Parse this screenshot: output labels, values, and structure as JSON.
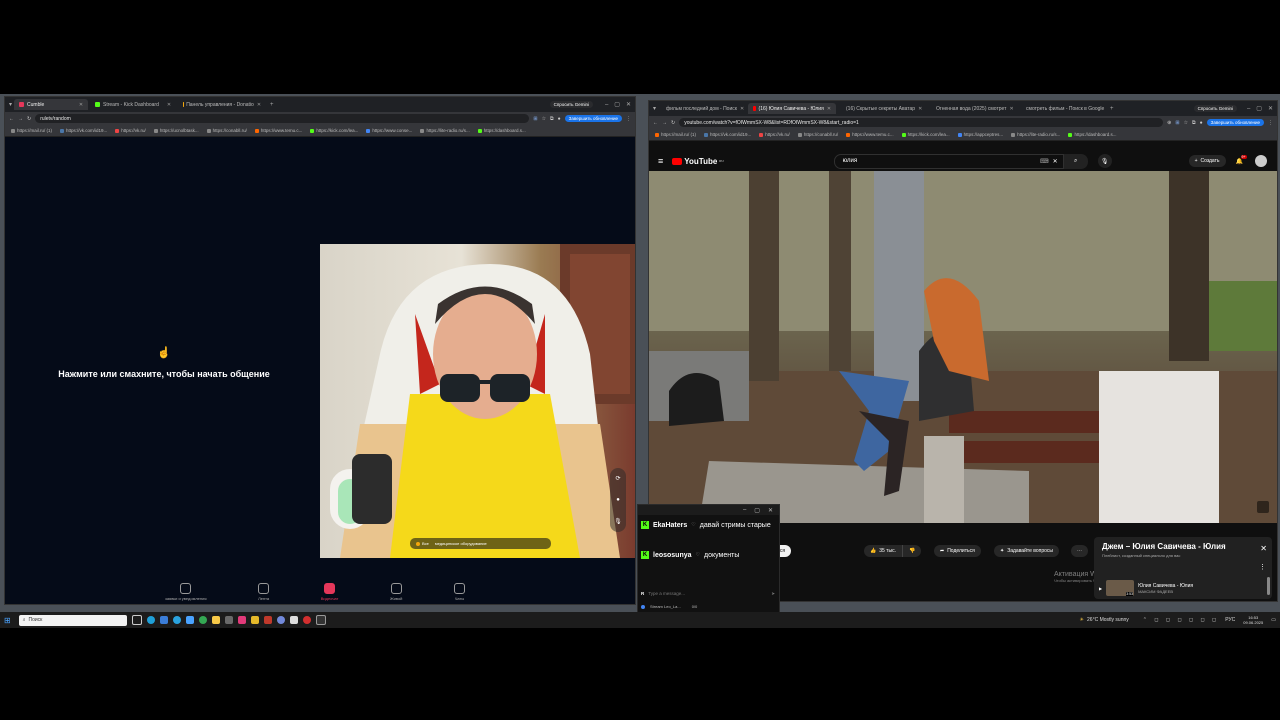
{
  "left_browser": {
    "gemini_label": "Спросить Gemini",
    "tabs": [
      {
        "label": "Cumble",
        "color": "#e6375a",
        "active": true
      },
      {
        "label": "Stream - Kick Dashboard",
        "color": "#53fc18",
        "active": false
      },
      {
        "label": "Панель управления - Donatio",
        "color": "#f4a70b",
        "active": false
      }
    ],
    "url": "ruletv/random",
    "update_label": "Завершить обновление",
    "bookmarks": [
      "https://mail.ru/ (1)",
      "https://vk.com/id19...",
      "https://vk.ru/",
      "https://ucnolbtask...",
      "https://conabll.ru/",
      "https://www.temu.c...",
      "https://kick.com/lea...",
      "https://www.conse...",
      "https://lite-radio.ru/s...",
      "https://dashboard.s..."
    ],
    "prompt": "Нажмите или смахните, чтобы начать общение",
    "cam_overlay": {
      "all_label": "Все",
      "equipment_label": "медицинское оборудование"
    },
    "bottom_nav": [
      {
        "label": "заявки и уведомления",
        "icon": "person-icon",
        "active": false
      },
      {
        "label": "Лента",
        "icon": "feed-icon",
        "active": false
      },
      {
        "label": "Видеочат",
        "icon": "video-chat-icon",
        "active": true
      },
      {
        "label": "Живой",
        "icon": "live-icon",
        "active": false
      },
      {
        "label": "Чаты",
        "icon": "chats-icon",
        "active": false
      }
    ]
  },
  "right_browser": {
    "gemini_label": "Спросить Gemini",
    "tabs": [
      {
        "label": "фильм последний дом - Поиск",
        "color": "#4285f4",
        "active": false
      },
      {
        "label": "(16) Юлия Савичева - Юлия",
        "color": "#ff0000",
        "active": true
      },
      {
        "label": "(16) Скрытые секреты Аватар",
        "color": "#ff0000",
        "active": false
      },
      {
        "label": "Огненная вода (2025) смотрет",
        "color": "#777777",
        "active": false
      },
      {
        "label": "смотреть фильм - Поиск в Google",
        "color": "#4285f4",
        "active": false
      }
    ],
    "url": "youtube.com/watch?v=fOIWmmSX-W8&list=RDfOIWmmSX-W8&start_radio=1",
    "update_label": "Завершить обновление",
    "bookmarks": [
      "https://mail.ru/ (1)",
      "https://vk.com/id19...",
      "https://vk.ru/",
      "https://conabll.ru/",
      "https://www.temu.c...",
      "https://kick.com/lea...",
      "https://appceptres...",
      "https://lite-radio.ru/s...",
      "https://dashboard.s..."
    ],
    "youtube": {
      "logo": "YouTube",
      "logo_sup": "RU",
      "search_value": "юлия",
      "create_label": "Создать",
      "notif_count": "9+",
      "subscribe_label": "ться",
      "likes": "35 тыс.",
      "share_label": "Поделиться",
      "ask_label": "Задавайте вопросы",
      "playlist_title": "Джем – Юлия Савичева - Юлия",
      "playlist_sub": "Плейлист, созданный специально для вас",
      "video_title": "Юлия Савичева - Юлия",
      "video_channel": "МАКСИМ ФАДЕЕВ",
      "video_duration": "3:53",
      "activation_title": "Активация Windows",
      "activation_sub": "Чтобы активировать Windows, перейдите"
    }
  },
  "chat": {
    "messages": [
      {
        "user": "EkaHaters",
        "text": "давай стримы старые"
      },
      {
        "user": "leososunya",
        "text": "документы"
      }
    ],
    "input_placeholder": "Type a message...",
    "count": "0/0",
    "status_label": "Stream Leo_La..."
  },
  "taskbar": {
    "search_placeholder": "Поиск",
    "weather": "26°C  Mostly sunny",
    "lang": "РУС",
    "time": "16:53",
    "date": "09.06.2025"
  }
}
